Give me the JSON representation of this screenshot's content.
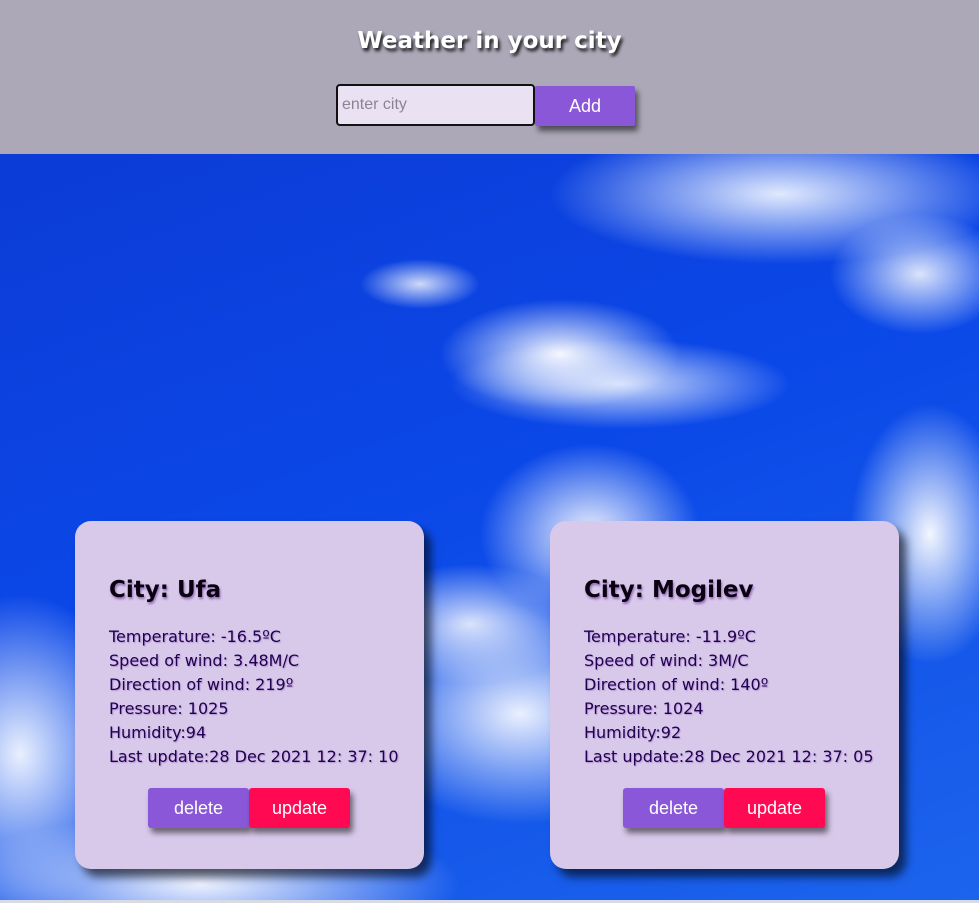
{
  "header": {
    "title": "Weather in your city",
    "search_placeholder": "enter city",
    "search_value": "",
    "add_label": "Add"
  },
  "cards": [
    {
      "title": "City: Ufa",
      "temperature": "Temperature: -16.5ºC",
      "wind_speed": "Speed of wind: 3.48M/C",
      "wind_direction": "Direction of wind: 219º",
      "pressure": "Pressure: 1025",
      "humidity": "Humidity:94",
      "last_update": "Last update:28 Dec 2021 12: 37: 10",
      "delete_label": "delete",
      "update_label": "update"
    },
    {
      "title": "City: Mogilev",
      "temperature": "Temperature: -11.9ºC",
      "wind_speed": "Speed of wind: 3M/C",
      "wind_direction": "Direction of wind: 140º",
      "pressure": "Pressure: 1024",
      "humidity": "Humidity:92",
      "last_update": "Last update:28 Dec 2021 12: 37: 05",
      "delete_label": "delete",
      "update_label": "update"
    }
  ],
  "colors": {
    "header_bg": "#aca8b8",
    "card_bg": "#d8c8ea",
    "primary_button": "#8a57d9",
    "update_button": "#ff0a52",
    "sky": "#0b48e8"
  }
}
